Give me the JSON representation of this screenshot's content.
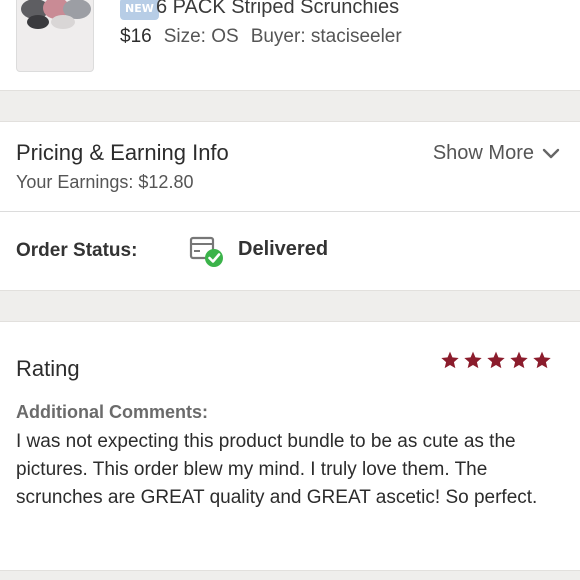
{
  "listing": {
    "badge": "NEW",
    "title": "6 PACK Striped Scrunchies",
    "price": "$16",
    "size": "Size: OS",
    "buyer": "Buyer: staciseeler"
  },
  "pricing": {
    "title": "Pricing & Earning Info",
    "earnings": "Your Earnings: $12.80",
    "show_more": "Show More"
  },
  "order_status": {
    "label": "Order Status:",
    "value": "Delivered"
  },
  "rating": {
    "title": "Rating",
    "stars": 5,
    "star_color": "#8b1c2c",
    "comments_label": "Additional Comments:",
    "comments": "I was not expecting this product bundle to be as cute as the pictures. This order blew my mind. I truly love them. The scrunches are GREAT quality and GREAT ascetic! So perfect."
  },
  "colors": {
    "badge_bg": "#b7cde6",
    "delivered_check": "#3bb34a",
    "gap_bg": "#efeeec"
  }
}
